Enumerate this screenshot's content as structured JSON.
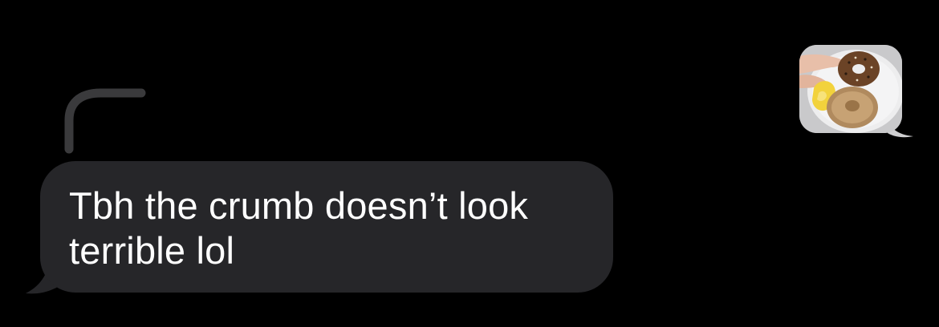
{
  "conversation": {
    "messages": [
      {
        "type": "photo",
        "direction": "outgoing",
        "image_description_icon": "photo-bagel-icon"
      },
      {
        "type": "text",
        "direction": "incoming",
        "is_reply": true,
        "text": "Tbh the crumb doesn’t look terrible lol"
      }
    ]
  },
  "colors": {
    "background": "#000000",
    "incoming_bubble": "#262629",
    "reply_line": "#3a3a3c",
    "text": "#ffffff"
  }
}
